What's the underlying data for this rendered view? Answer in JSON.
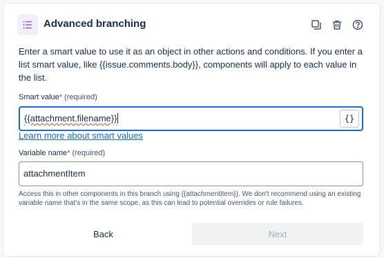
{
  "header": {
    "title": "Advanced branching",
    "icon": "list-icon",
    "actions": [
      {
        "name": "duplicate-icon"
      },
      {
        "name": "delete-icon"
      },
      {
        "name": "help-icon"
      }
    ]
  },
  "description": "Enter a smart value to use it as an object in other actions and conditions. If you enter a list smart value, like {{issue.comments.body}}, components will apply to each value in the list.",
  "smart_value": {
    "label": "Smart value",
    "required_mark": "*",
    "required_text": "(required)",
    "value": "{{attachment.filename}}",
    "insert_button": "{}"
  },
  "learn_more_link": "Learn more about smart values",
  "variable_name": {
    "label": "Variable name",
    "required_mark": "*",
    "required_text": "(required)",
    "value": "attachmentItem",
    "helper": "Access this in other components in this branch using {{attachmentItem}}. We don't recommend using an existing variable name that's in the same scope, as this can lead to potential overrides or rule failures."
  },
  "footer": {
    "back_label": "Back",
    "next_label": "Next"
  },
  "colors": {
    "accent": "#1868db",
    "required": "#c9372c",
    "icon_bg": "#f3eefe",
    "icon_fg": "#8f5ad6"
  }
}
